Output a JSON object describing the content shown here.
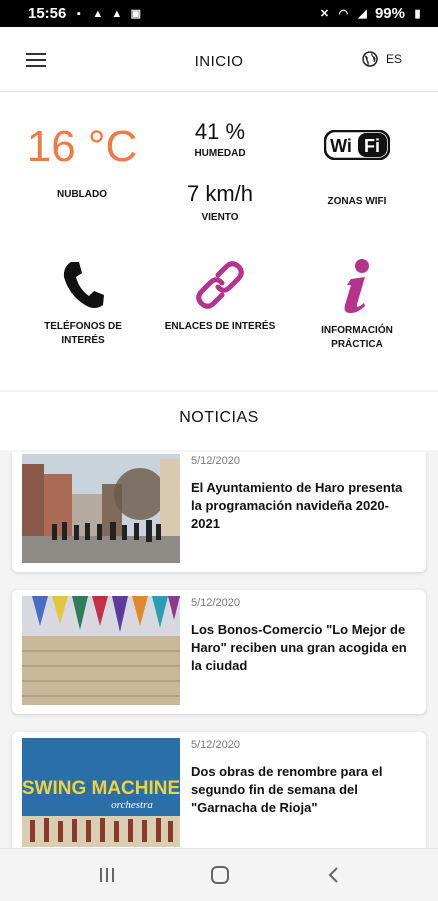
{
  "status_bar": {
    "time": "15:56",
    "battery": "99%"
  },
  "header": {
    "title": "INICIO",
    "language": "ES"
  },
  "weather": {
    "temperature": "16 °C",
    "condition": "NUBLADO",
    "humidity_value": "41 %",
    "humidity_label": "HUMEDAD",
    "wind_value": "7 km/h",
    "wind_label": "VIENTO",
    "accent_color": "#f07a45"
  },
  "wifi": {
    "label": "ZONAS WIFI",
    "icon": "wifi-logo-icon",
    "logo_text_left": "Wi",
    "logo_text_right": "Fi"
  },
  "quick_links": [
    {
      "label_line1": "TELÉFONOS DE",
      "label_line2": "INTERÉS",
      "icon": "phone-icon"
    },
    {
      "label_line1": "ENLACES DE INTERÉS",
      "label_line2": "",
      "icon": "link-icon"
    },
    {
      "label_line1": "INFORMACIÓN",
      "label_line2": "PRÁCTICA",
      "icon": "info-icon"
    }
  ],
  "accent_magenta": "#b5338a",
  "news": {
    "title": "NOTICIAS",
    "items": [
      {
        "date": "5/12/2020",
        "title": "El Ayuntamiento de Haro presenta la programación navideña 2020-2021",
        "image": "street-crowd-photo"
      },
      {
        "date": "5/12/2020",
        "title": "Los Bonos-Comercio \"Lo Mejor de Haro\" reciben una gran acogida en la ciudad",
        "image": "bunting-wall-photo"
      },
      {
        "date": "5/12/2020",
        "title": "Dos obras de renombre para el segundo fin de semana del \"Garnacha de Rioja\"",
        "image": "swing-machine-poster",
        "image_text_1": "SWING MACHINE",
        "image_text_2": "orchestra"
      }
    ]
  }
}
